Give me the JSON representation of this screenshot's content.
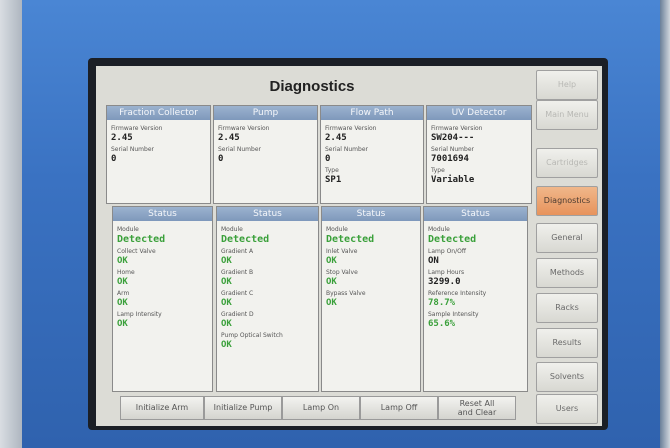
{
  "title": "Diagnostics",
  "panels_top": [
    {
      "header": "Fraction Collector",
      "fields": [
        {
          "label": "Firmware Version",
          "value": "2.45"
        },
        {
          "label": "Serial Number",
          "value": "0"
        }
      ]
    },
    {
      "header": "Pump",
      "fields": [
        {
          "label": "Firmware Version",
          "value": "2.45"
        },
        {
          "label": "Serial Number",
          "value": "0"
        }
      ]
    },
    {
      "header": "Flow Path",
      "fields": [
        {
          "label": "Firmware Version",
          "value": "2.45"
        },
        {
          "label": "Serial Number",
          "value": "0"
        },
        {
          "label": "Type",
          "value": "SP1"
        }
      ]
    },
    {
      "header": "UV Detector",
      "fields": [
        {
          "label": "Firmware Version",
          "value": "SW204---"
        },
        {
          "label": "Serial Number",
          "value": "7001694"
        },
        {
          "label": "Type",
          "value": "Variable"
        }
      ]
    }
  ],
  "panels_status": [
    {
      "header": "Status",
      "fields": [
        {
          "label": "Module",
          "value": "Detected"
        },
        {
          "label": "Collect Valve",
          "value": "OK"
        },
        {
          "label": "Home",
          "value": "OK"
        },
        {
          "label": "Arm",
          "value": "OK"
        },
        {
          "label": "Lamp Intensity",
          "value": "OK"
        }
      ]
    },
    {
      "header": "Status",
      "fields": [
        {
          "label": "Module",
          "value": "Detected"
        },
        {
          "label": "Gradient A",
          "value": "OK"
        },
        {
          "label": "Gradient B",
          "value": "OK"
        },
        {
          "label": "Gradient C",
          "value": "OK"
        },
        {
          "label": "Gradient D",
          "value": "OK"
        },
        {
          "label": "Pump Optical Switch",
          "value": "OK"
        }
      ]
    },
    {
      "header": "Status",
      "fields": [
        {
          "label": "Module",
          "value": "Detected"
        },
        {
          "label": "Inlet Valve",
          "value": "OK"
        },
        {
          "label": "Stop Valve",
          "value": "OK"
        },
        {
          "label": "Bypass Valve",
          "value": "OK"
        }
      ]
    },
    {
      "header": "Status",
      "fields": [
        {
          "label": "Module",
          "value": "Detected"
        },
        {
          "label": "Lamp On/Off",
          "value": "ON"
        },
        {
          "label": "Lamp Hours",
          "value": "3299.0"
        },
        {
          "label": "Reference Intensity",
          "value": "78.7%"
        },
        {
          "label": "Sample Intensity",
          "value": "65.6%"
        }
      ]
    }
  ],
  "buttons": {
    "initialize_arm": "Initialize Arm",
    "initialize_pump": "Initialize Pump",
    "lamp_on": "Lamp On",
    "lamp_off": "Lamp Off",
    "reset_all_line1": "Reset All",
    "reset_all_line2": "and Clear"
  },
  "side_tabs": {
    "help": "Help",
    "main_menu": "Main Menu",
    "cartridges": "Cartridges",
    "diagnostics": "Diagnostics",
    "general": "General",
    "methods": "Methods",
    "racks": "Racks",
    "results": "Results",
    "solvents": "Solvents",
    "users": "Users"
  },
  "colors": {
    "bezel": "#3a72c2",
    "header": "#8aa3c4",
    "active_tab": "#e9a070",
    "ok_green": "#3aa03a"
  }
}
